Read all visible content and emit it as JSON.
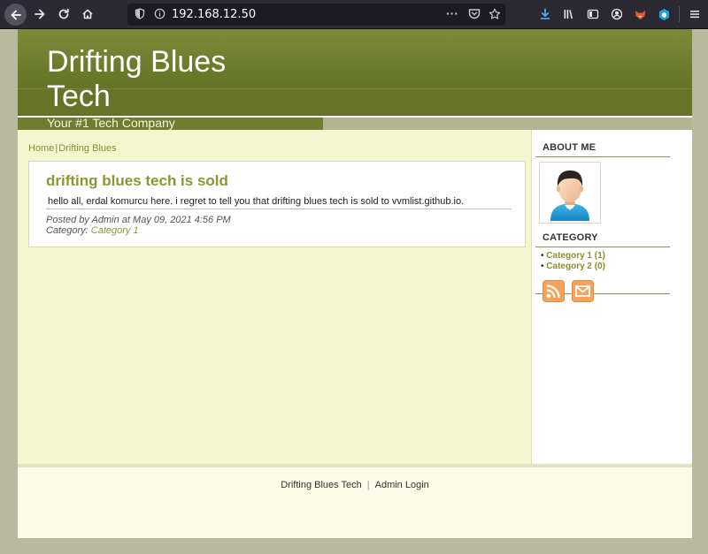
{
  "browser": {
    "url": "192.168.12.50",
    "page_actions_icon": "···"
  },
  "site": {
    "title": "Drifting Blues Tech",
    "tagline": "Your #1 Tech Company"
  },
  "breadcrumb": {
    "home": "Home",
    "separator": "|",
    "current": "Drifting Blues"
  },
  "post": {
    "title": "drifting blues tech is sold",
    "body": "hello all, erdal komurcu here. i regret to tell you that drifting blues tech is sold to vvmlist.github.io.",
    "meta_posted": "Posted by Admin at May 09, 2021 4:56 PM",
    "meta_category_label": "Category:",
    "meta_category_link": "Category 1"
  },
  "sidebar": {
    "about_heading": "ABOUT ME",
    "category_heading": "CATEGORY",
    "categories": [
      {
        "bullet": "•",
        "label": "Category 1 (1)"
      },
      {
        "bullet": "•",
        "label": "Category 2 (0)"
      }
    ],
    "feed_icons": [
      "rss-icon",
      "email-icon"
    ]
  },
  "footer": {
    "site_link": "Drifting Blues Tech",
    "separator": "|",
    "admin_link": "Admin Login"
  },
  "colors": {
    "header": "#6c7a2c",
    "accent": "#8d9532",
    "main_bg": "#f4f6cf",
    "toolbar": "#2b2a33"
  }
}
